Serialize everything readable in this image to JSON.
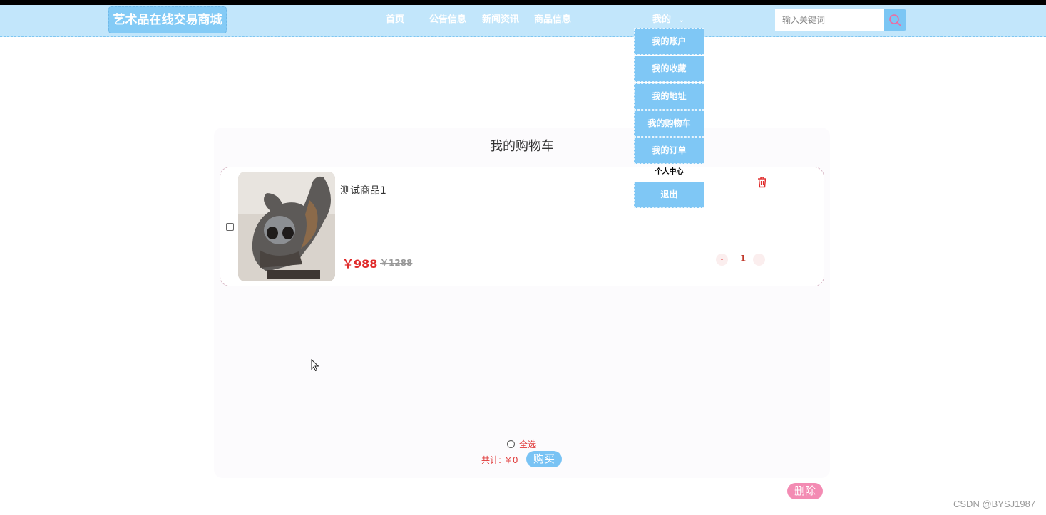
{
  "header": {
    "logo": "艺术品在线交易商城",
    "nav": [
      "首页",
      "公告信息",
      "新闻资讯",
      "商品信息"
    ],
    "my_menu": "我的",
    "search_placeholder": "输入关键词"
  },
  "dropdown": {
    "items": [
      "我的账户",
      "我的收藏",
      "我的地址",
      "我的购物车",
      "我的订单"
    ],
    "personal_center": "个人中心",
    "logout": "退出"
  },
  "cart": {
    "title": "我的购物车",
    "item": {
      "name": "测试商品1",
      "price": "￥988",
      "old_price": "￥1288",
      "quantity": "1",
      "minus": "-",
      "plus": "+"
    },
    "select_all": "全选",
    "total_label": "共计:",
    "total_value": "￥0",
    "buy": "购买",
    "delete": "删除"
  },
  "watermark": "CSDN @BYSJ1987",
  "colors": {
    "nav_bg": "#c2e6fb",
    "accent": "#7fc7f5",
    "price": "#e02b2b",
    "delete": "#f38bb3"
  }
}
